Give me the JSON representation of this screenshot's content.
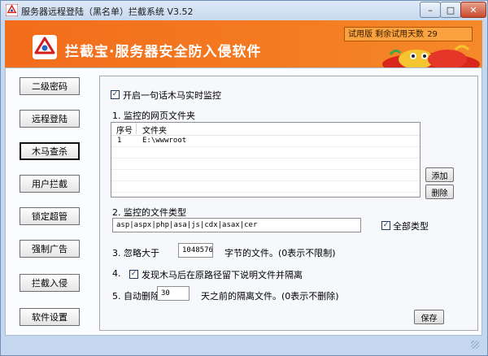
{
  "window": {
    "title": "服务器远程登陆（黑名单）拦截系统 V3.52"
  },
  "banner": {
    "title": "拦截宝·服务器安全防入侵软件",
    "trial_label": "试用版  剩余试用天数",
    "trial_days": "29"
  },
  "nav": {
    "items": [
      {
        "label": "二级密码"
      },
      {
        "label": "远程登陆"
      },
      {
        "label": "木马查杀"
      },
      {
        "label": "用户拦截"
      },
      {
        "label": "锁定超管"
      },
      {
        "label": "强制广告"
      },
      {
        "label": "拦截入侵"
      },
      {
        "label": "软件设置"
      }
    ],
    "active_index": 2
  },
  "panel": {
    "realtime_monitor": {
      "label": "开启一句话木马实时监控",
      "checked": true
    },
    "section1_label": "1. 监控的网页文件夹",
    "folder_table": {
      "columns": [
        "序号",
        "文件夹"
      ],
      "rows": [
        {
          "index": "1",
          "path": "E:\\wwwroot"
        }
      ]
    },
    "add_button": "添加",
    "delete_button": "删除",
    "section2_label": "2. 监控的文件类型",
    "file_types": "asp|aspx|php|asa|js|cdx|asax|cer",
    "all_types": {
      "label": "全部类型",
      "checked": true
    },
    "section3_prefix": "3. 忽略大于",
    "ignore_size": "1048576",
    "section3_suffix": "字节的文件。(0表示不限制)",
    "section4_number": "4.",
    "leave_note": {
      "label": "发现木马后在原路径留下说明文件并隔离",
      "checked": true
    },
    "section5_prefix": "5. 自动删除",
    "delete_days": "30",
    "section5_suffix": "天之前的隔离文件。(0表示不删除)",
    "save_button": "保存"
  },
  "colors": {
    "banner_orange": "#f26d1c",
    "window_frame": "#c4d7ee"
  },
  "icons": {
    "app": "shield-logo-icon",
    "banner_logo": "shield-logo-icon",
    "decor": "lion-dance-icon"
  }
}
